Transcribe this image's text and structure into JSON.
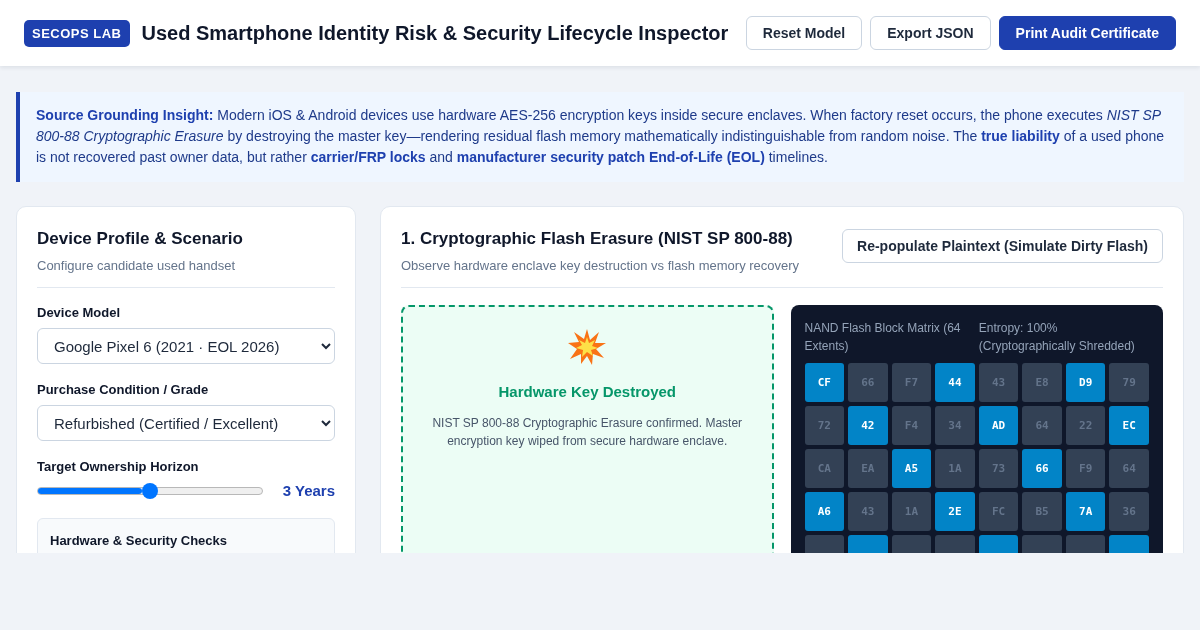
{
  "header": {
    "badge": "SECOPS LAB",
    "title": "Used Smartphone Identity Risk & Security Lifecycle Inspector",
    "buttons": [
      {
        "label": "Reset Model",
        "kind": "outline"
      },
      {
        "label": "Export JSON",
        "kind": "outline"
      },
      {
        "label": "Print Audit Certificate",
        "kind": "primary"
      }
    ]
  },
  "insight": {
    "text": "**Source Grounding Insight:** Modern iOS & Android devices use hardware AES-256 encryption keys inside secure enclaves. When factory reset occurs, the phone executes *NIST SP 800-88 Cryptographic Erasure* by destroying the master key—rendering residual flash memory mathematically indistinguishable from random noise. The **true liability** of a used phone is not recovered past owner data, but rather **carrier/FRP locks** and **manufacturer security patch End-of-Life (EOL)** timelines."
  },
  "profile": {
    "title": "Device Profile & Scenario",
    "subtitle": "Configure candidate used handset",
    "device_model": {
      "label": "Device Model",
      "value": "Google Pixel 6 (2021 · EOL 2026)"
    },
    "condition": {
      "label": "Purchase Condition / Grade",
      "value": "Refurbished (Certified / Excellent)"
    },
    "horizon": {
      "label": "Target Ownership Horizon",
      "level": 0.5,
      "reading": "3 Years"
    },
    "checks": {
      "title": "Hardware & Security Checks"
    }
  },
  "erasure": {
    "title": "1. Cryptographic Flash Erasure (NIST SP 800-88)",
    "subtitle": "Observe hardware enclave key destruction vs flash memory recovery",
    "button": "Re-populate Plaintext (Simulate Dirty Flash)",
    "key_status": {
      "title": "Hardware Key Destroyed",
      "text": "NIST SP 800-88 Cryptographic Erasure confirmed. Master encryption key wiped from secure hardware enclave."
    },
    "matrix": {
      "title": "NAND Flash Block Matrix (64 Extents)",
      "entropy": "Entropy: 100% (Cryptographically Shredded)",
      "cells": [
        {
          "text": "CF",
          "highlighted": true
        },
        {
          "text": "66",
          "highlighted": false
        },
        {
          "text": "F7",
          "highlighted": false
        },
        {
          "text": "44",
          "highlighted": true
        },
        {
          "text": "43",
          "highlighted": false
        },
        {
          "text": "E8",
          "highlighted": false
        },
        {
          "text": "D9",
          "highlighted": true
        },
        {
          "text": "79",
          "highlighted": false
        },
        {
          "text": "72",
          "highlighted": false
        },
        {
          "text": "42",
          "highlighted": true
        },
        {
          "text": "F4",
          "highlighted": false
        },
        {
          "text": "34",
          "highlighted": false
        },
        {
          "text": "AD",
          "highlighted": true
        },
        {
          "text": "64",
          "highlighted": false
        },
        {
          "text": "22",
          "highlighted": false
        },
        {
          "text": "EC",
          "highlighted": true
        },
        {
          "text": "CA",
          "highlighted": false
        },
        {
          "text": "EA",
          "highlighted": false
        },
        {
          "text": "A5",
          "highlighted": true
        },
        {
          "text": "1A",
          "highlighted": false
        },
        {
          "text": "73",
          "highlighted": false
        },
        {
          "text": "66",
          "highlighted": true
        },
        {
          "text": "F9",
          "highlighted": false
        },
        {
          "text": "64",
          "highlighted": false
        },
        {
          "text": "A6",
          "highlighted": true
        },
        {
          "text": "43",
          "highlighted": false
        },
        {
          "text": "1A",
          "highlighted": false
        },
        {
          "text": "2E",
          "highlighted": true
        },
        {
          "text": "FC",
          "highlighted": false
        },
        {
          "text": "B5",
          "highlighted": false
        },
        {
          "text": "7A",
          "highlighted": true
        },
        {
          "text": "36",
          "highlighted": false
        },
        {
          "highlighted": false
        },
        {
          "highlighted": true
        },
        {
          "highlighted": false
        },
        {
          "highlighted": false
        },
        {
          "highlighted": true
        },
        {
          "highlighted": false
        },
        {
          "highlighted": false
        },
        {
          "highlighted": true
        }
      ]
    }
  }
}
